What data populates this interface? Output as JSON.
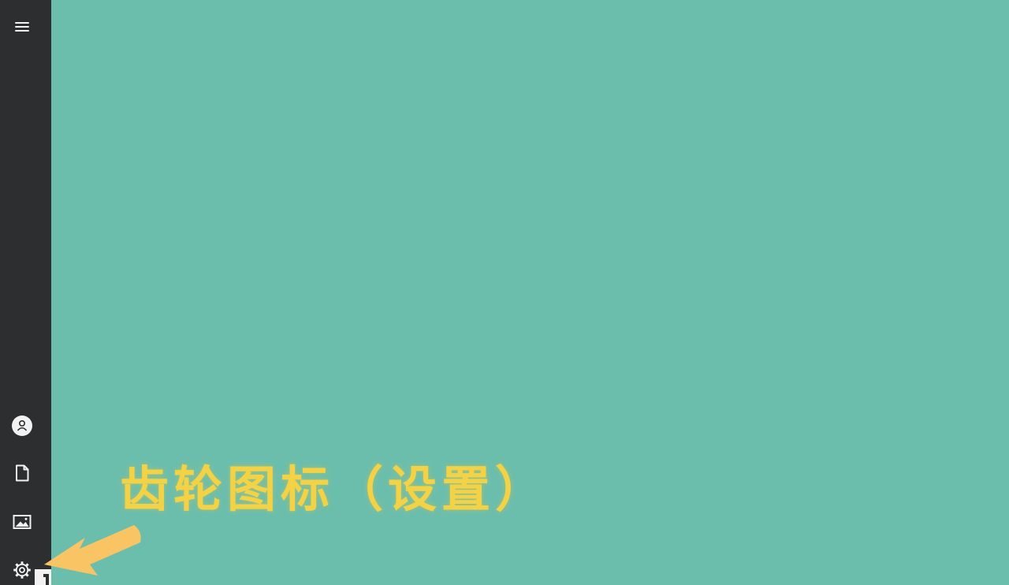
{
  "colors": {
    "sidebar_bg": "#2d2e30",
    "main_bg": "#6cbeac",
    "icon": "#f2f2f2",
    "callout_text": "#f3d246",
    "arrow": "#f9c463"
  },
  "sidebar": {
    "items": [
      {
        "id": "menu",
        "icon": "hamburger-menu-icon"
      },
      {
        "id": "account",
        "icon": "user-circle-icon"
      },
      {
        "id": "documents",
        "icon": "document-icon"
      },
      {
        "id": "pictures",
        "icon": "image-icon"
      },
      {
        "id": "settings",
        "icon": "gear-icon"
      }
    ]
  },
  "annotation": {
    "text": "齿轮图标（设置）",
    "arrow_icon": "arrow-pointer-icon"
  }
}
